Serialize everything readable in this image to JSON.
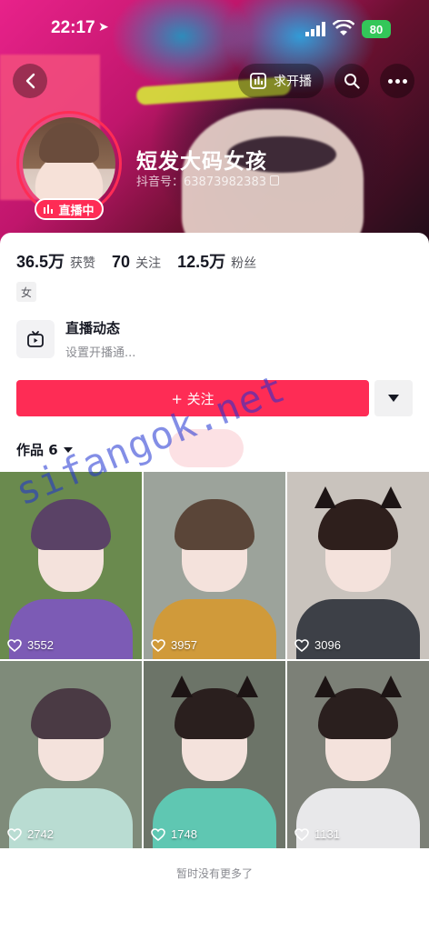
{
  "status_bar": {
    "time": "22:17",
    "battery": "80"
  },
  "top_bar": {
    "request_live_label": "求开播"
  },
  "profile": {
    "name": "短发大码女孩",
    "douyin_id": "抖音号：63873982383",
    "live_badge": "直播中",
    "stats": [
      {
        "value": "36.5万",
        "label": "获赞"
      },
      {
        "value": "70",
        "label": "关注"
      },
      {
        "value": "12.5万",
        "label": "粉丝"
      }
    ],
    "gender_tag": "女"
  },
  "live_dynamic": {
    "title": "直播动态",
    "subtitle": "设置开播通..."
  },
  "follow_button": {
    "label": "+ 关注"
  },
  "works_tab": {
    "label": "作品 6"
  },
  "videos": [
    {
      "likes": "3552",
      "bg": "#6a8a4e",
      "hair": "#5a4266",
      "top": "#7c5bb5",
      "ears": false
    },
    {
      "likes": "3957",
      "bg": "#9ca39b",
      "hair": "#5a4538",
      "top": "#d09a3a",
      "ears": false
    },
    {
      "likes": "3096",
      "bg": "#c9c3bd",
      "hair": "#2e1f1c",
      "top": "#3d4047",
      "ears": true
    },
    {
      "likes": "2742",
      "bg": "#7f8b7a",
      "hair": "#4a3a44",
      "top": "#b9dcd2",
      "ears": false
    },
    {
      "likes": "1748",
      "bg": "#6c7468",
      "hair": "#2a1f1e",
      "top": "#5fc7b2",
      "ears": true
    },
    {
      "likes": "1131",
      "bg": "#7c8077",
      "hair": "#2a1f1e",
      "top": "#e8e8ea",
      "ears": true
    }
  ],
  "footer": {
    "end_text": "暂时没有更多了"
  },
  "watermark": "sifangok.net",
  "colors": {
    "accent": "#fe2c55",
    "battery": "#33c759"
  }
}
